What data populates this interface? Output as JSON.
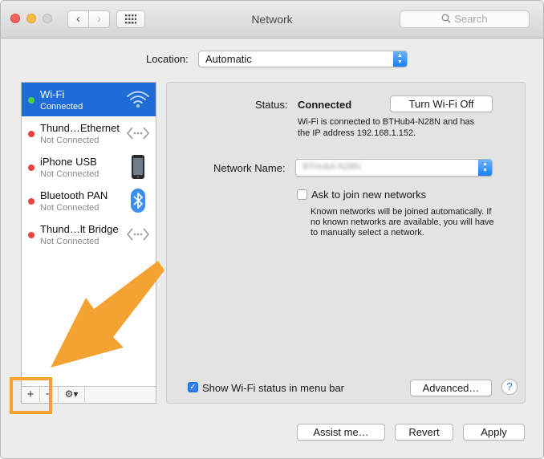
{
  "window": {
    "title": "Network",
    "search_placeholder": "Search",
    "back_glyph": "‹",
    "forward_glyph": "›",
    "grid_glyph": "⠿"
  },
  "location": {
    "label": "Location:",
    "value": "Automatic"
  },
  "services": [
    {
      "name": "Wi-Fi",
      "status": "Connected",
      "dot_color": "#4cd43d",
      "icon": "wifi-icon",
      "selected": true
    },
    {
      "name": "Thund…Ethernet",
      "status": "Not Connected",
      "dot_color": "#e8433c",
      "icon": "ethernet-arrows-icon"
    },
    {
      "name": "iPhone USB",
      "status": "Not Connected",
      "dot_color": "#e8433c",
      "icon": "iphone-icon"
    },
    {
      "name": "Bluetooth PAN",
      "status": "Not Connected",
      "dot_color": "#e8433c",
      "icon": "bluetooth-icon"
    },
    {
      "name": "Thund…lt Bridge",
      "status": "Not Connected",
      "dot_color": "#e8433c",
      "icon": "bridge-arrows-icon"
    }
  ],
  "sidebar_buttons": {
    "add": "+",
    "remove": "−",
    "gear_menu": "⚙▾"
  },
  "detail": {
    "status_label": "Status:",
    "status_value": "Connected",
    "turn_off_button": "Turn Wi-Fi Off",
    "status_desc_1": "Wi-Fi is connected to BTHub4-N28N and has",
    "status_desc_2": "the IP address 192.168.1.152.",
    "network_name_label": "Network Name:",
    "network_name_value": "BTHub4-N28N",
    "ask_join_label": "Ask to join new networks",
    "ask_join_checked": false,
    "ask_join_desc_1": "Known networks will be joined automatically. If",
    "ask_join_desc_2": "no known networks are available, you will have",
    "ask_join_desc_3": "to manually select a network.",
    "show_status_label": "Show Wi-Fi status in menu bar",
    "show_status_checked": true,
    "advanced_button": "Advanced…",
    "help_button": "?"
  },
  "footer": {
    "assist_button": "Assist me…",
    "revert_button": "Revert",
    "apply_button": "Apply"
  },
  "colors": {
    "selection": "#1f6cd8",
    "accent_blue": "#1a7ef5",
    "highlight_orange": "#f4a231"
  }
}
